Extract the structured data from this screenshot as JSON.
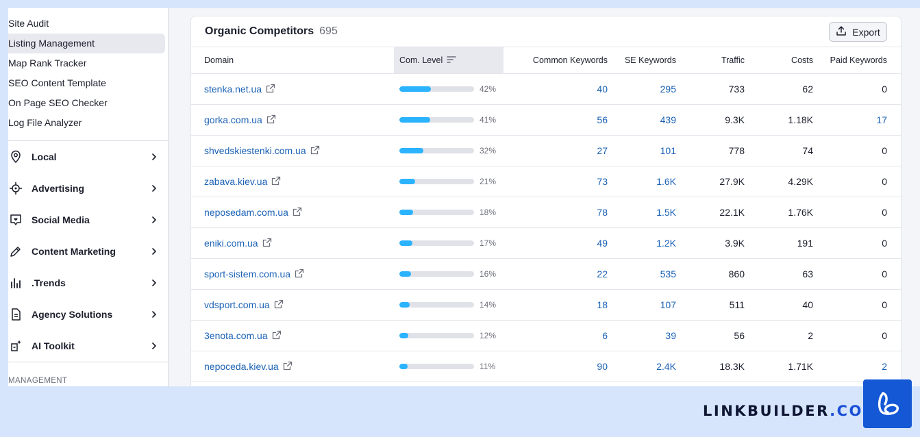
{
  "sidebar": {
    "sub_items": [
      {
        "label": "Site Audit",
        "active": false
      },
      {
        "label": "Listing Management",
        "active": true
      },
      {
        "label": "Map Rank Tracker",
        "active": false
      },
      {
        "label": "SEO Content Template",
        "active": false
      },
      {
        "label": "On Page SEO Checker",
        "active": false
      },
      {
        "label": "Log File Analyzer",
        "active": false
      }
    ],
    "nav_items": [
      {
        "label": "Local",
        "icon": "location-pin-icon"
      },
      {
        "label": "Advertising",
        "icon": "target-icon"
      },
      {
        "label": "Social Media",
        "icon": "chat-bubble-icon"
      },
      {
        "label": "Content Marketing",
        "icon": "pencil-icon"
      },
      {
        "label": ".Trends",
        "icon": "bar-chart-icon"
      },
      {
        "label": "Agency Solutions",
        "icon": "document-icon"
      },
      {
        "label": "AI Toolkit",
        "icon": "ai-sparkle-icon"
      }
    ],
    "section_label": "MANAGEMENT"
  },
  "card": {
    "title": "Organic Competitors",
    "count": "695",
    "export_label": "Export"
  },
  "table": {
    "headers": {
      "domain": "Domain",
      "com_level": "Com. Level",
      "common_keywords": "Common Keywords",
      "se_keywords": "SE Keywords",
      "traffic": "Traffic",
      "costs": "Costs",
      "paid_keywords": "Paid Keywords"
    },
    "rows": [
      {
        "domain": "stenka.net.ua",
        "level": 42,
        "level_label": "42%",
        "common": "40",
        "se": "295",
        "traffic": "733",
        "costs": "62",
        "paid": "0"
      },
      {
        "domain": "gorka.com.ua",
        "level": 41,
        "level_label": "41%",
        "common": "56",
        "se": "439",
        "traffic": "9.3K",
        "costs": "1.18K",
        "paid": "17"
      },
      {
        "domain": "shvedskiestenki.com.ua",
        "level": 32,
        "level_label": "32%",
        "common": "27",
        "se": "101",
        "traffic": "778",
        "costs": "74",
        "paid": "0"
      },
      {
        "domain": "zabava.kiev.ua",
        "level": 21,
        "level_label": "21%",
        "common": "73",
        "se": "1.6K",
        "traffic": "27.9K",
        "costs": "4.29K",
        "paid": "0"
      },
      {
        "domain": "neposedam.com.ua",
        "level": 18,
        "level_label": "18%",
        "common": "78",
        "se": "1.5K",
        "traffic": "22.1K",
        "costs": "1.76K",
        "paid": "0"
      },
      {
        "domain": "eniki.com.ua",
        "level": 17,
        "level_label": "17%",
        "common": "49",
        "se": "1.2K",
        "traffic": "3.9K",
        "costs": "191",
        "paid": "0"
      },
      {
        "domain": "sport-sistem.com.ua",
        "level": 16,
        "level_label": "16%",
        "common": "22",
        "se": "535",
        "traffic": "860",
        "costs": "63",
        "paid": "0"
      },
      {
        "domain": "vdsport.com.ua",
        "level": 14,
        "level_label": "14%",
        "common": "18",
        "se": "107",
        "traffic": "511",
        "costs": "40",
        "paid": "0"
      },
      {
        "domain": "3enota.com.ua",
        "level": 12,
        "level_label": "12%",
        "common": "6",
        "se": "39",
        "traffic": "56",
        "costs": "2",
        "paid": "0"
      },
      {
        "domain": "nepoceda.kiev.ua",
        "level": 11,
        "level_label": "11%",
        "common": "90",
        "se": "2.4K",
        "traffic": "18.3K",
        "costs": "1.71K",
        "paid": "2"
      }
    ]
  },
  "branding": {
    "name": "LINKBUILDER",
    "dot": ".",
    "tld": "COM",
    "logo_icon": "linkbuilder-logo-icon"
  },
  "colors": {
    "accent_blue": "#1a61b5",
    "bar_fill": "#2bb3ff",
    "brand_blue": "#1558d6",
    "background": "#d6e5fb"
  }
}
